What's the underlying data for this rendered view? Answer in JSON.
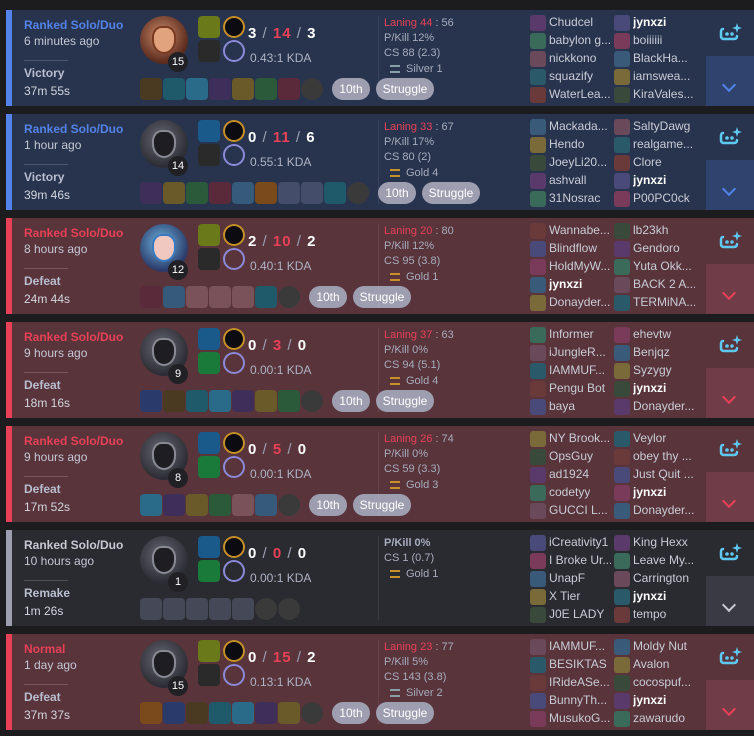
{
  "colors": {
    "win_bg": "#28344e",
    "loss_bg": "#59343b",
    "remake_bg": "#2a2a31",
    "win_accent": "#5383e8",
    "loss_accent": "#e84057",
    "remake_accent": "#9e9eb1"
  },
  "icons": {
    "ai": "ai-sparkle-icon",
    "expand": "chevron-down-icon",
    "silver": "silver-rank-icon",
    "gold": "gold-rank-icon"
  },
  "matches": [
    {
      "queue": "Ranked Solo/Duo",
      "ago": "6 minutes ago",
      "result": "Victory",
      "duration": "37m 55s",
      "champ_level": "15",
      "kills": "3",
      "deaths": "14",
      "assists": "3",
      "kda_ratio": "0.43:1 KDA",
      "laning_label": "Laning 44",
      "laning_opp": "56",
      "pkill": "P/Kill 12%",
      "cs": "CS 88 (2.3)",
      "rank": "Silver 1",
      "tags": [
        "10th",
        "Struggle"
      ],
      "team1": [
        "Chudcel",
        "babylon g...",
        "nickkono",
        "squazify",
        "WaterLea..."
      ],
      "team2": [
        "jynxzi",
        "boiiiiii",
        "BlackHa...",
        "iamswea...",
        "KiraVales..."
      ]
    },
    {
      "queue": "Ranked Solo/Duo",
      "ago": "1 hour ago",
      "result": "Victory",
      "duration": "39m 46s",
      "champ_level": "14",
      "kills": "0",
      "deaths": "11",
      "assists": "6",
      "kda_ratio": "0.55:1 KDA",
      "laning_label": "Laning 33",
      "laning_opp": "67",
      "pkill": "P/Kill 17%",
      "cs": "CS 80 (2)",
      "rank": "Gold 4",
      "tags": [
        "10th",
        "Struggle"
      ],
      "team1": [
        "Mackada...",
        "Hendo",
        "JoeyLi20...",
        "ashvall",
        "31Nosrac"
      ],
      "team2": [
        "SaltyDawg",
        "realgame...",
        "Clore",
        "jynxzi",
        "P00PC0ck"
      ]
    },
    {
      "queue": "Ranked Solo/Duo",
      "ago": "8 hours ago",
      "result": "Defeat",
      "duration": "24m 44s",
      "champ_level": "12",
      "kills": "2",
      "deaths": "10",
      "assists": "2",
      "kda_ratio": "0.40:1 KDA",
      "laning_label": "Laning 20",
      "laning_opp": "80",
      "pkill": "P/Kill 12%",
      "cs": "CS 95 (3.8)",
      "rank": "Gold 1",
      "tags": [
        "10th",
        "Struggle"
      ],
      "team1": [
        "Wannabe...",
        "Blindflow",
        "HoldMyW...",
        "jynxzi",
        "Donayder..."
      ],
      "team2": [
        "lb23kh",
        "Gendoro",
        "Yuta Okk...",
        "BACK 2 A...",
        "TERMiNA..."
      ]
    },
    {
      "queue": "Ranked Solo/Duo",
      "ago": "9 hours ago",
      "result": "Defeat",
      "duration": "18m 16s",
      "champ_level": "9",
      "kills": "0",
      "deaths": "3",
      "assists": "0",
      "kda_ratio": "0.00:1 KDA",
      "laning_label": "Laning 37",
      "laning_opp": "63",
      "pkill": "P/Kill 0%",
      "cs": "CS 94 (5.1)",
      "rank": "Gold 4",
      "tags": [
        "10th",
        "Struggle"
      ],
      "team1": [
        "Informer",
        "iJungleR...",
        "IAMMUF...",
        "Pengu Bot",
        "baya"
      ],
      "team2": [
        "ehevtw",
        "Benjqz",
        "Syzygy",
        "jynxzi",
        "Donayder..."
      ]
    },
    {
      "queue": "Ranked Solo/Duo",
      "ago": "9 hours ago",
      "result": "Defeat",
      "duration": "17m 52s",
      "champ_level": "8",
      "kills": "0",
      "deaths": "5",
      "assists": "0",
      "kda_ratio": "0.00:1 KDA",
      "laning_label": "Laning 26",
      "laning_opp": "74",
      "pkill": "P/Kill 0%",
      "cs": "CS 59 (3.3)",
      "rank": "Gold 3",
      "tags": [
        "10th",
        "Struggle"
      ],
      "team1": [
        "NY Brook...",
        "OpsGuy",
        "ad1924",
        "codetyy",
        "GUCCI L..."
      ],
      "team2": [
        "Veylor",
        "obey thy ...",
        "Just Quit ...",
        "jynxzi",
        "Donayder..."
      ]
    },
    {
      "queue": "Ranked Solo/Duo",
      "ago": "10 hours ago",
      "result": "Remake",
      "duration": "1m 26s",
      "champ_level": "1",
      "kills": "0",
      "deaths": "0",
      "assists": "0",
      "kda_ratio": "0.00:1 KDA",
      "laning_label": "",
      "laning_opp": "",
      "pkill": "P/Kill 0%",
      "cs": "CS 1 (0.7)",
      "rank": "Gold 1",
      "tags": [],
      "team1": [
        "iCreativity1",
        "I Broke Ur...",
        "UnapF",
        "X Tier",
        "J0E LADY"
      ],
      "team2": [
        "King Hexx",
        "Leave My...",
        "Carrington",
        "jynxzi",
        "tempo"
      ]
    },
    {
      "queue": "Normal",
      "ago": "1 day ago",
      "result": "Defeat",
      "duration": "37m 37s",
      "champ_level": "15",
      "kills": "0",
      "deaths": "15",
      "assists": "2",
      "kda_ratio": "0.13:1 KDA",
      "laning_label": "Laning 23",
      "laning_opp": "77",
      "pkill": "P/Kill 5%",
      "cs": "CS 143 (3.8)",
      "rank": "Silver 2",
      "tags": [
        "10th",
        "Struggle"
      ],
      "team1": [
        "IAMMUF...",
        "BESIKTAS",
        "IRideASe...",
        "BunnyTh...",
        "MusukoG..."
      ],
      "team2": [
        "Moldy Nut",
        "Avalon",
        "cocospuf...",
        "jynxzi",
        "zawarudo"
      ]
    }
  ]
}
